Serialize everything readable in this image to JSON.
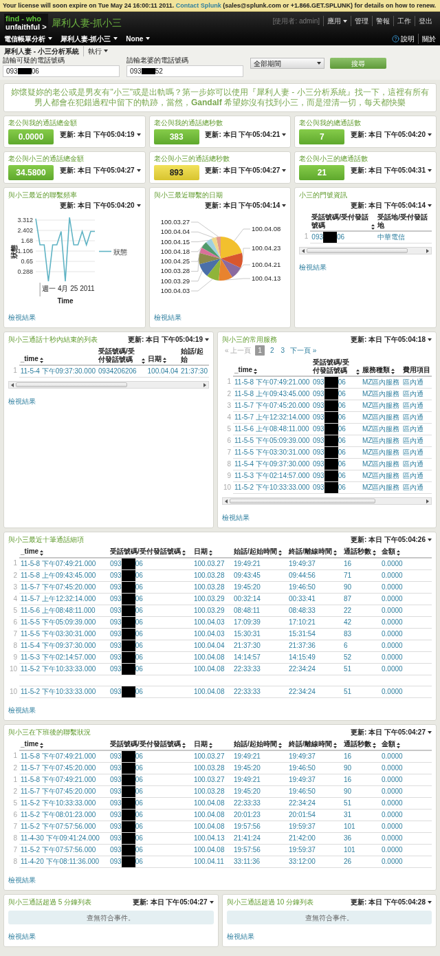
{
  "license_bar": {
    "text": "Your license will soon expire on Tue May 24 16:00:11 2011.",
    "link": "Contact Splunk",
    "rest": "(sales@splunk.com or +1.866.GET.SPLUNK) for details on how to renew."
  },
  "header": {
    "logo_top": "find - who",
    "logo_bottom": "unfaithful >",
    "app_title": "犀利人妻-抓小三",
    "user": "[使用者: admin]",
    "top_links": [
      {
        "label": "應用",
        "menu": true
      },
      {
        "label": "管理",
        "menu": false
      },
      {
        "label": "警報",
        "menu": false
      },
      {
        "label": "工作",
        "menu": false
      },
      {
        "label": "登出",
        "menu": false
      }
    ]
  },
  "nav": {
    "items": [
      {
        "label": "電信帳單分析"
      },
      {
        "label": "犀利人妻-抓小三"
      },
      {
        "label": "None"
      }
    ],
    "help": "說明",
    "about": "關於"
  },
  "breadcrumb": {
    "title": "犀利人妻 - 小三分析系統",
    "action": "執行"
  },
  "form": {
    "fields": [
      {
        "label": "請輸可疑的電話號碼",
        "start": "093",
        "end": "06"
      },
      {
        "label": "請輸老婆的電話號碼",
        "start": "093",
        "end": "52"
      }
    ],
    "time_range": "全部期間",
    "search_button": "搜尋"
  },
  "intro": "妳懷疑妳的老公或是男友有\"小三\"或是出軌嗎？第一步妳可以使用『犀利人妻 - 小三分析系統』找一下，這裡有所有男人都會在犯錯過程中留下的軌跡，當然，**Gandalf** 希望妳沒有找到小三，而是澄清一切，每天都快樂",
  "stats": [
    {
      "title": "老公與我的通話總金額",
      "updated": "更新: 本日 下午05:04:19",
      "value": "0.0000",
      "kind": "normal"
    },
    {
      "title": "老公與我的通話總秒數",
      "updated": "更新: 本日 下午05:04:21",
      "value": "383",
      "kind": "normal"
    },
    {
      "title": "老公與我的總通話數",
      "updated": "更新: 本日 下午05:04:20",
      "value": "7",
      "kind": "normal"
    },
    {
      "title": "老公與小三的通話總金額",
      "updated": "更新: 本日 下午05:04:27",
      "value": "34.5800",
      "kind": "normal"
    },
    {
      "title": "老公與小三的通話總秒數",
      "updated": "更新: 本日 下午05:04:27",
      "value": "893",
      "kind": "elevated"
    },
    {
      "title": "老公與小三的總通話數",
      "updated": "更新: 本日 下午05:04:31",
      "value": "21",
      "kind": "normal"
    }
  ],
  "frequency_panel": {
    "title": "與小三最近的聯繫頻率",
    "updated": "更新: 本日 下午05:04:20",
    "link": "檢視結果",
    "chart": {
      "y_axis_title": "狀態",
      "y_tick_labels": [
        "3.312",
        "2.402",
        "1.68",
        "1.106",
        "0.65",
        "0.288"
      ],
      "x_tick_label": "週一 4月 25 2011",
      "x_axis_title": "Time",
      "legend": "狀態"
    }
  },
  "dates_panel": {
    "title": "與小三最近聯繫的日期",
    "updated": "更新: 本日 下午05:04:14",
    "link": "檢視結果",
    "slices": [
      {
        "label": "100.03.27",
        "color": "#e39a8a"
      },
      {
        "label": "100.04.04",
        "color": "#f0d88a"
      },
      {
        "label": "100.04.15",
        "color": "#9fd0df"
      },
      {
        "label": "100.04.18",
        "color": "#4f9a6a"
      },
      {
        "label": "100.04.25",
        "color": "#d9709a"
      },
      {
        "label": "100.03.28",
        "color": "#8c8a4a"
      },
      {
        "label": "100.03.29",
        "color": "#4a6fa8"
      },
      {
        "label": "100.04.03",
        "color": "#8fb43a"
      },
      {
        "label": "100.04.08",
        "color": "#f2c02e"
      },
      {
        "label": "100.04.23",
        "color": "#d9572e"
      },
      {
        "label": "100.04.21",
        "color": "#8a6aa0"
      },
      {
        "label": "100.04.13",
        "color": "#e8832e"
      }
    ]
  },
  "number_panel": {
    "title": "小三的門號資訊",
    "updated": "更新: 本日 下午05:04:14",
    "link": "檢視結果",
    "columns": [
      {
        "label": "受話號碼/受付發話號碼",
        "sortable": true
      },
      {
        "label": "受話地/受付發話地",
        "sortable": false
      }
    ],
    "rows": [
      {
        "num": "1",
        "cells": [
          {
            "start": "093",
            "end": "06"
          },
          "中華電信"
        ]
      }
    ]
  },
  "short_calls_panel": {
    "title": "與小三通話十秒內結束的列表",
    "updated": "更新: 本日 下午05:04:19",
    "link": "檢視結果",
    "columns": [
      {
        "label": "_time",
        "sortable": true
      },
      {
        "label": "受話號碼/受付發話號碼",
        "sortable": true
      },
      {
        "label": "日期",
        "sortable": true
      },
      {
        "label": "始話/起始",
        "sortable": false
      }
    ],
    "rows": [
      {
        "num": "1",
        "cells": [
          "11-5-4 下午09:37:30.000",
          "0934206206",
          "100.04.04",
          "21:37:30"
        ]
      }
    ]
  },
  "services_panel": {
    "title": "與小三的常用服務",
    "updated": "更新: 本日 下午05:04:18",
    "link": "檢視結果",
    "pager": {
      "prev": {
        "label": "« 上一頁",
        "disabled": true
      },
      "pages": [
        {
          "label": "1",
          "selected": true
        },
        {
          "label": "2",
          "selected": false
        },
        {
          "label": "3",
          "selected": false
        }
      ],
      "next": {
        "label": "下一頁 »",
        "disabled": false
      }
    },
    "columns": [
      {
        "label": "_time",
        "sortable": true
      },
      {
        "label": "受話號碼/受付發話號碼",
        "sortable": true
      },
      {
        "label": "服務種類",
        "sortable": true
      },
      {
        "label": "費用項目",
        "sortable": false
      }
    ],
    "rows": [
      {
        "num": "1",
        "cells": [
          "11-5-8 下午07:49:21.000",
          {
            "start": "093",
            "end": "06"
          },
          "MZ區內服務",
          "區內通"
        ]
      },
      {
        "num": "2",
        "cells": [
          "11-5-8 上午09:43:45.000",
          {
            "start": "093",
            "end": "06"
          },
          "MZ區內服務",
          "區內通"
        ]
      },
      {
        "num": "3",
        "cells": [
          "11-5-7 下午07:45:20.000",
          {
            "start": "093",
            "end": "06"
          },
          "MZ區內服務",
          "區內通"
        ]
      },
      {
        "num": "4",
        "cells": [
          "11-5-7 上午12:32:14.000",
          {
            "start": "093",
            "end": "06"
          },
          "MZ區內服務",
          "區內通"
        ]
      },
      {
        "num": "5",
        "cells": [
          "11-5-6 上午08:48:11.000",
          {
            "start": "093",
            "end": "06"
          },
          "MZ區內服務",
          "區內通"
        ]
      },
      {
        "num": "6",
        "cells": [
          "11-5-5 下午05:09:39.000",
          {
            "start": "093",
            "end": "06"
          },
          "MZ區內服務",
          "區內通"
        ]
      },
      {
        "num": "7",
        "cells": [
          "11-5-5 下午03:30:31.000",
          {
            "start": "093",
            "end": "06"
          },
          "MZ區內服務",
          "區內通"
        ]
      },
      {
        "num": "8",
        "cells": [
          "11-5-4 下午09:37:30.000",
          {
            "start": "093",
            "end": "06"
          },
          "MZ區內服務",
          "區內通"
        ]
      },
      {
        "num": "9",
        "cells": [
          "11-5-3 下午02:14:57.000",
          {
            "start": "093",
            "end": "06"
          },
          "MZ區內服務",
          "區內通"
        ]
      },
      {
        "num": "10",
        "cells": [
          "11-5-2 下午10:33:33.000",
          {
            "start": "093",
            "end": "06"
          },
          "MZ區內服務",
          "區內通"
        ]
      }
    ]
  },
  "recent_panel": {
    "title": "與小三最近十筆通話細項",
    "updated": "更新: 本日 下午05:04:26",
    "link": "檢視結果",
    "columns": [
      {
        "label": "_time",
        "sortable": true
      },
      {
        "label": "受話號碼/受付發話號碼",
        "sortable": true
      },
      {
        "label": "日期",
        "sortable": true
      },
      {
        "label": "始話/起始時間",
        "sortable": true
      },
      {
        "label": "終話/離線時間",
        "sortable": true
      },
      {
        "label": "通話秒數",
        "sortable": true
      },
      {
        "label": "金額",
        "sortable": true
      }
    ],
    "rows": [
      {
        "kind": "data",
        "num": "1",
        "cells": [
          "11-5-8 下午07:49:21.000",
          {
            "start": "093",
            "end": "06"
          },
          "100.03.27",
          "19:49:21",
          "19:49:37",
          "16",
          "0.0000"
        ]
      },
      {
        "kind": "data",
        "num": "2",
        "cells": [
          "11-5-8 上午09:43:45.000",
          {
            "start": "093",
            "end": "06"
          },
          "100.03.28",
          "09:43:45",
          "09:44:56",
          "71",
          "0.0000"
        ]
      },
      {
        "kind": "data",
        "num": "3",
        "cells": [
          "11-5-7 下午07:45:20.000",
          {
            "start": "093",
            "end": "06"
          },
          "100.03.28",
          "19:45:20",
          "19:46:50",
          "90",
          "0.0000"
        ]
      },
      {
        "kind": "data",
        "num": "4",
        "cells": [
          "11-5-7 上午12:32:14.000",
          {
            "start": "093",
            "end": "06"
          },
          "100.03.29",
          "00:32:14",
          "00:33:41",
          "87",
          "0.0000"
        ]
      },
      {
        "kind": "data",
        "num": "5",
        "cells": [
          "11-5-6 上午08:48:11.000",
          {
            "start": "093",
            "end": "06"
          },
          "100.03.29",
          "08:48:11",
          "08:48:33",
          "22",
          "0.0000"
        ]
      },
      {
        "kind": "data",
        "num": "6",
        "cells": [
          "11-5-5 下午05:09:39.000",
          {
            "start": "093",
            "end": "06"
          },
          "100.04.03",
          "17:09:39",
          "17:10:21",
          "42",
          "0.0000"
        ]
      },
      {
        "kind": "data",
        "num": "7",
        "cells": [
          "11-5-5 下午03:30:31.000",
          {
            "start": "093",
            "end": "06"
          },
          "100.04.03",
          "15:30:31",
          "15:31:54",
          "83",
          "0.0000"
        ]
      },
      {
        "kind": "data",
        "num": "8",
        "cells": [
          "11-5-4 下午09:37:30.000",
          {
            "start": "093",
            "end": "06"
          },
          "100.04.04",
          "21:37:30",
          "21:37:36",
          "6",
          "0.0000"
        ]
      },
      {
        "kind": "data",
        "num": "9",
        "cells": [
          "11-5-3 下午02:14:57.000",
          {
            "start": "093",
            "end": "06"
          },
          "100.04.08",
          "14:14:57",
          "14:15:49",
          "52",
          "0.0000"
        ]
      },
      {
        "kind": "data",
        "num": "10",
        "cells": [
          "11-5-2 下午10:33:33.000",
          {
            "start": "093",
            "end": "06"
          },
          "100.04.08",
          "22:33:33",
          "22:34:24",
          "51",
          "0.0000"
        ]
      },
      {
        "kind": "blank"
      },
      {
        "kind": "data",
        "num": "10",
        "cells": [
          "11-5-2 下午10:33:33.000",
          {
            "start": "093",
            "end": "06"
          },
          "100.04.08",
          "22:33:33",
          "22:34:24",
          "51",
          "0.0000"
        ]
      }
    ]
  },
  "after_work_panel": {
    "title": "與小三在下班後的聯繫狀況",
    "updated": "更新: 本日 下午05:04:27",
    "link": "檢視結果",
    "columns": [
      {
        "label": "_time",
        "sortable": true
      },
      {
        "label": "受話號碼/受付發話號碼",
        "sortable": true
      },
      {
        "label": "日期",
        "sortable": true
      },
      {
        "label": "始話/起始時間",
        "sortable": true
      },
      {
        "label": "終話/離線時間",
        "sortable": true
      },
      {
        "label": "通話秒數",
        "sortable": true
      },
      {
        "label": "金額",
        "sortable": true
      }
    ],
    "rows": [
      {
        "num": "1",
        "cells": [
          "11-5-8 下午07:49:21.000",
          {
            "start": "093",
            "end": "06"
          },
          "100.03.27",
          "19:49:21",
          "19:49:37",
          "16",
          "0.0000"
        ]
      },
      {
        "num": "2",
        "cells": [
          "11-5-7 下午07:45:20.000",
          {
            "start": "093",
            "end": "06"
          },
          "100.03.28",
          "19:45:20",
          "19:46:50",
          "90",
          "0.0000"
        ]
      },
      {
        "num": "1",
        "cells": [
          "11-5-8 下午07:49:21.000",
          {
            "start": "093",
            "end": "06"
          },
          "100.03.27",
          "19:49:21",
          "19:49:37",
          "16",
          "0.0000"
        ]
      },
      {
        "num": "2",
        "cells": [
          "11-5-7 下午07:45:20.000",
          {
            "start": "093",
            "end": "06"
          },
          "100.03.28",
          "19:45:20",
          "19:46:50",
          "90",
          "0.0000"
        ]
      },
      {
        "num": "5",
        "cells": [
          "11-5-2 下午10:33:33.000",
          {
            "start": "093",
            "end": "06"
          },
          "100.04.08",
          "22:33:33",
          "22:34:24",
          "51",
          "0.0000"
        ]
      },
      {
        "num": "6",
        "cells": [
          "11-5-2 下午08:01:23.000",
          {
            "start": "093",
            "end": "06"
          },
          "100.04.08",
          "20:01:23",
          "20:01:54",
          "31",
          "0.0000"
        ]
      },
      {
        "num": "7",
        "cells": [
          "11-5-2 下午07:57:56.000",
          {
            "start": "093",
            "end": "06"
          },
          "100.04.08",
          "19:57:56",
          "19:59:37",
          "101",
          "0.0000"
        ]
      },
      {
        "num": "8",
        "cells": [
          "11-4-30 下午09:41:24.000",
          {
            "start": "093",
            "end": "06"
          },
          "100.04.13",
          "21:41:24",
          "21:42:00",
          "36",
          "0.0000"
        ]
      },
      {
        "num": "7",
        "cells": [
          "11-5-2 下午07:57:56.000",
          {
            "start": "093",
            "end": "06"
          },
          "100.04.08",
          "19:57:56",
          "19:59:37",
          "101",
          "0.0000"
        ]
      },
      {
        "num": "8",
        "cells": [
          "11-4-20 下午08:11:36.000",
          {
            "start": "093",
            "end": "06"
          },
          "100.04.11",
          "33:11:36",
          "33:12:00",
          "26",
          "0.0000"
        ]
      }
    ]
  },
  "empty_panels": [
    {
      "title": "與小三通話超過 5 分鐘列表",
      "updated": "更新: 本日 下午05:04:27",
      "message": "查無符合事件。",
      "link": "檢視結果"
    },
    {
      "title": "與小三通話超過 10 分鐘列表",
      "updated": "更新: 本日 下午05:04:28",
      "message": "查無符合事件。",
      "link": "檢視結果"
    }
  ]
}
